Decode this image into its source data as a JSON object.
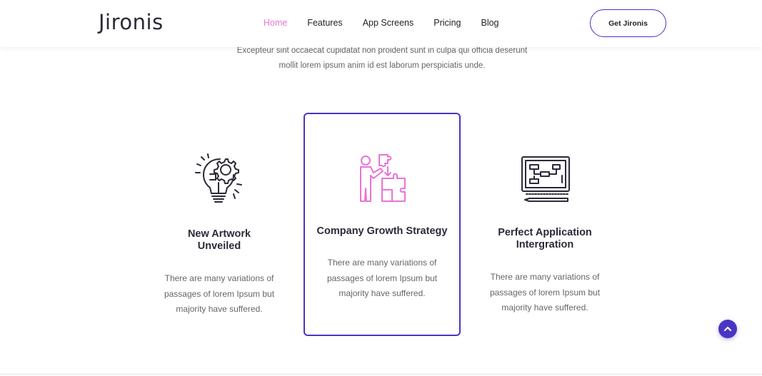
{
  "header": {
    "logo": "Jironis",
    "nav": [
      "Home",
      "Features",
      "App Screens",
      "Pricing",
      "Blog"
    ],
    "active_nav": "Home",
    "cta_label": "Get Jironis"
  },
  "intro": {
    "line1": "Excepteur sint occaecat cupidatat non proident sunt in culpa qui officia deserunt",
    "line2": "mollit lorem ipsum anim id est laborum perspiciatis unde."
  },
  "features": [
    {
      "icon": "lightbulb-gear-icon",
      "title_line1": "New Artwork",
      "title_line2": "Unveiled",
      "desc_line1": "There are many variations of",
      "desc_line2": "passages of lorem Ipsum but",
      "desc_line3": "majority have suffered."
    },
    {
      "icon": "person-puzzle-icon",
      "title_line1": "Company Growth Strategy",
      "desc_line1": "There are many variations of",
      "desc_line2": "passages of lorem Ipsum but",
      "desc_line3": "majority have suffered.",
      "highlighted": true
    },
    {
      "icon": "monitor-flowchart-icon",
      "title_line1": "Perfect Application",
      "title_line2": "Intergration",
      "desc_line1": "There are many variations of",
      "desc_line2": "passages of lorem Ipsum but",
      "desc_line3": "majority have suffered."
    }
  ],
  "colors": {
    "accent": "#4a34c4",
    "pink": "#ea73d6",
    "text_dark": "#2a2a3a",
    "text_muted": "#666666"
  },
  "scroll_top_icon": "chevron-up-icon"
}
